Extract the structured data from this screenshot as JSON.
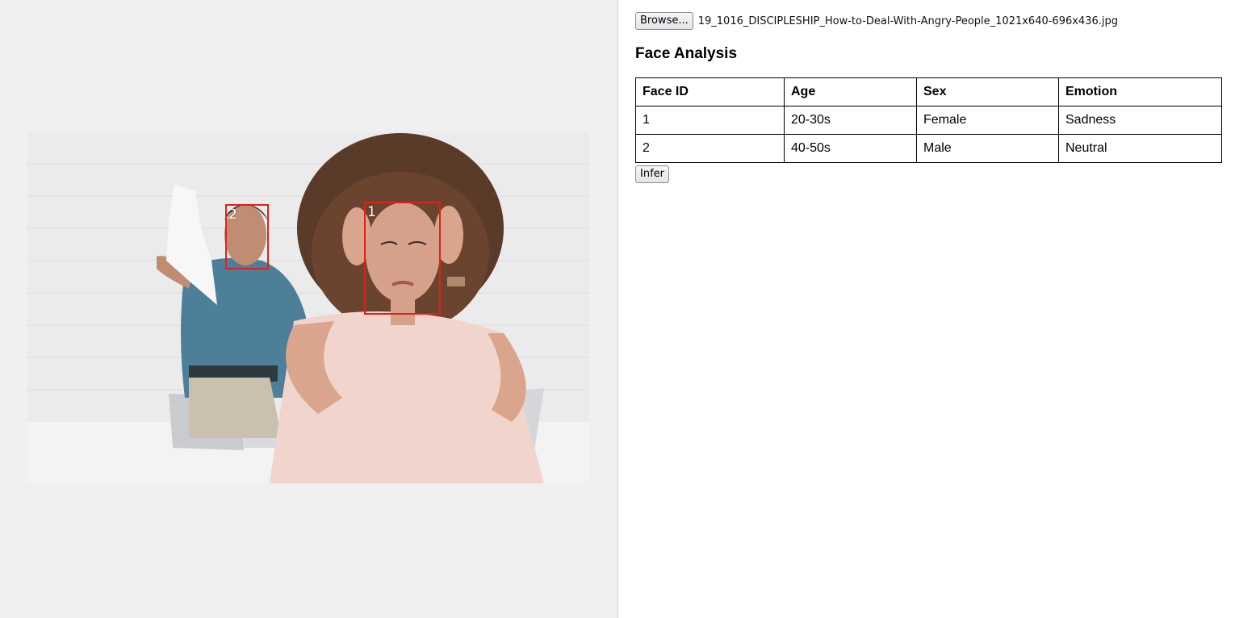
{
  "file_picker": {
    "browse_label": "Browse...",
    "file_name": "19_1016_DISCIPLESHIP_How-to-Deal-With-Angry-People_1021x640-696x436.jpg"
  },
  "analysis": {
    "title": "Face Analysis",
    "columns": [
      "Face ID",
      "Age",
      "Sex",
      "Emotion"
    ],
    "rows": [
      {
        "id": "1",
        "age": "20-30s",
        "sex": "Female",
        "emotion": "Sadness"
      },
      {
        "id": "2",
        "age": "40-50s",
        "sex": "Male",
        "emotion": "Neutral"
      }
    ]
  },
  "faces": [
    {
      "label": "1"
    },
    {
      "label": "2"
    }
  ],
  "infer_label": "Infer",
  "colors": {
    "box": "#e0201c",
    "left_bg": "#f0f0f0"
  }
}
